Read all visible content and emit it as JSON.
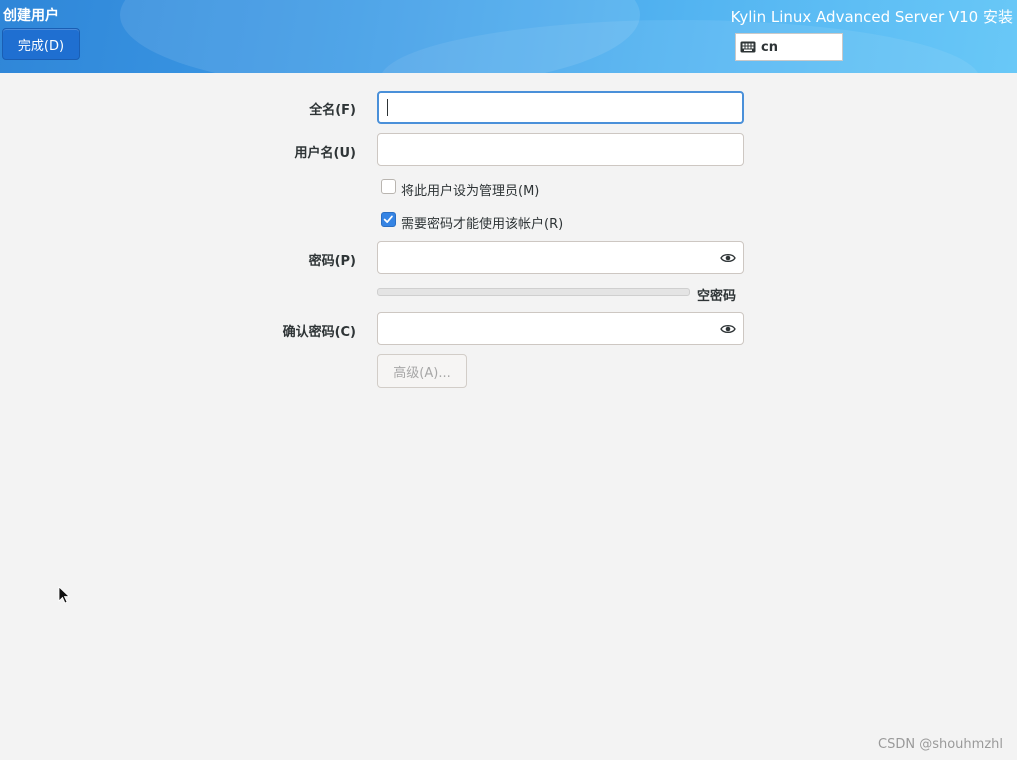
{
  "header": {
    "title": "创建用户",
    "done_label": "完成(D)",
    "product_title": "Kylin Linux Advanced Server V10 安装",
    "keyboard_layout": "cn"
  },
  "form": {
    "fullname_label": "全名(F)",
    "fullname_value": "",
    "username_label": "用户名(U)",
    "username_value": "",
    "admin_checkbox_label": "将此用户设为管理员(M)",
    "admin_checked": false,
    "require_password_label": "需要密码才能使用该帐户(R)",
    "require_password_checked": true,
    "password_label": "密码(P)",
    "password_value": "",
    "password_strength": 0,
    "password_strength_label": "空密码",
    "confirm_label": "确认密码(C)",
    "confirm_value": "",
    "advanced_label": "高级(A)..."
  },
  "watermark": "CSDN @shouhmzhl",
  "colors": {
    "header_accent": "#2f86d8",
    "primary_button": "#1f6fd1",
    "checkbox_checked": "#3584e4",
    "focus_border": "#4a90d9"
  },
  "icons": {
    "keyboard": "keyboard-icon",
    "password_reveal": "eye-icon",
    "checkmark": "checkmark-icon",
    "cursor": "mouse-pointer-icon"
  }
}
